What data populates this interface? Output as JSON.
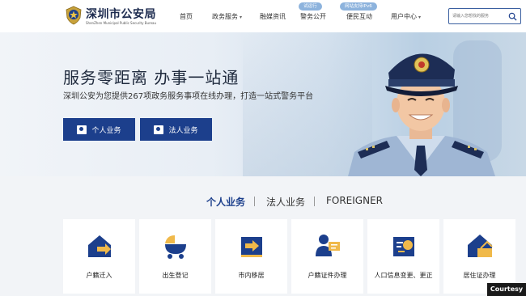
{
  "header": {
    "site_title": "深圳市公安局",
    "site_subtitle": "ShenZhen Municipal Public Security Bureau",
    "nav": [
      {
        "label": "首页",
        "has_caret": false
      },
      {
        "label": "政务服务",
        "has_caret": true
      },
      {
        "label": "融媒资讯",
        "has_caret": false
      },
      {
        "label": "警务公开",
        "has_caret": false,
        "badge": "试运行"
      },
      {
        "label": "便民互动",
        "has_caret": false,
        "badge": "网站支持IPv6"
      },
      {
        "label": "用户中心",
        "has_caret": true
      }
    ],
    "search_placeholder": "请输入您想找的服务"
  },
  "hero": {
    "title": "服务零距离 办事一站通",
    "subtitle": "深圳公安为您提供267项政务服务事项在线办理，打造一站式警务平台",
    "buttons": [
      {
        "label": "个人业务"
      },
      {
        "label": "法人业务"
      }
    ]
  },
  "tabs": [
    {
      "label": "个人业务",
      "active": true
    },
    {
      "label": "法人业务",
      "active": false
    },
    {
      "label": "FOREIGNER",
      "active": false
    }
  ],
  "services": [
    {
      "label": "户籍迁入",
      "icon": "house-arrow-icon"
    },
    {
      "label": "出生登记",
      "icon": "baby-cradle-icon"
    },
    {
      "label": "市内移居",
      "icon": "move-box-icon"
    },
    {
      "label": "户籍证件办理",
      "icon": "id-card-person-icon"
    },
    {
      "label": "人口信息变更、更正",
      "icon": "info-edit-icon"
    },
    {
      "label": "居住证办理",
      "icon": "residence-house-icon"
    }
  ],
  "watermark": "Courtesy",
  "colors": {
    "primary": "#1c3f8c",
    "accent_orange": "#f0b94a",
    "badge_blue": "#8db3dd",
    "panel_bg": "#f2f4f7"
  }
}
